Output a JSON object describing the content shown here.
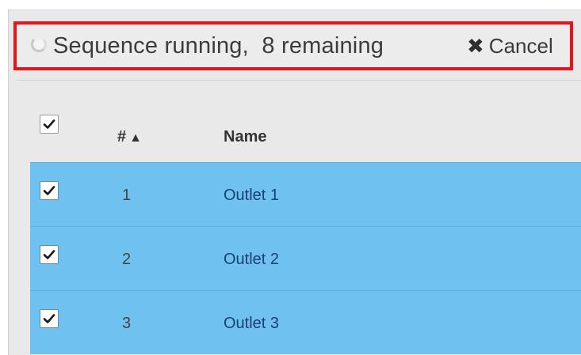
{
  "status_bar": {
    "text": "Sequence running,  8 remaining",
    "cancel_label": "Cancel",
    "cancel_icon": "close-x-icon",
    "spinner_icon": "spinner-icon",
    "highlight_color": "#e8141b"
  },
  "table": {
    "columns": [
      {
        "key": "select",
        "label": ""
      },
      {
        "key": "num",
        "label": "#",
        "sort": "ascending",
        "sort_icon": "▲"
      },
      {
        "key": "name",
        "label": "Name"
      }
    ],
    "select_all_checked": true,
    "rows": [
      {
        "num": "1",
        "name": "Outlet 1",
        "checked": true
      },
      {
        "num": "2",
        "name": "Outlet 2",
        "checked": true
      },
      {
        "num": "3",
        "name": "Outlet 3",
        "checked": true
      }
    ],
    "selected_row_color": "#6fc1ef"
  }
}
